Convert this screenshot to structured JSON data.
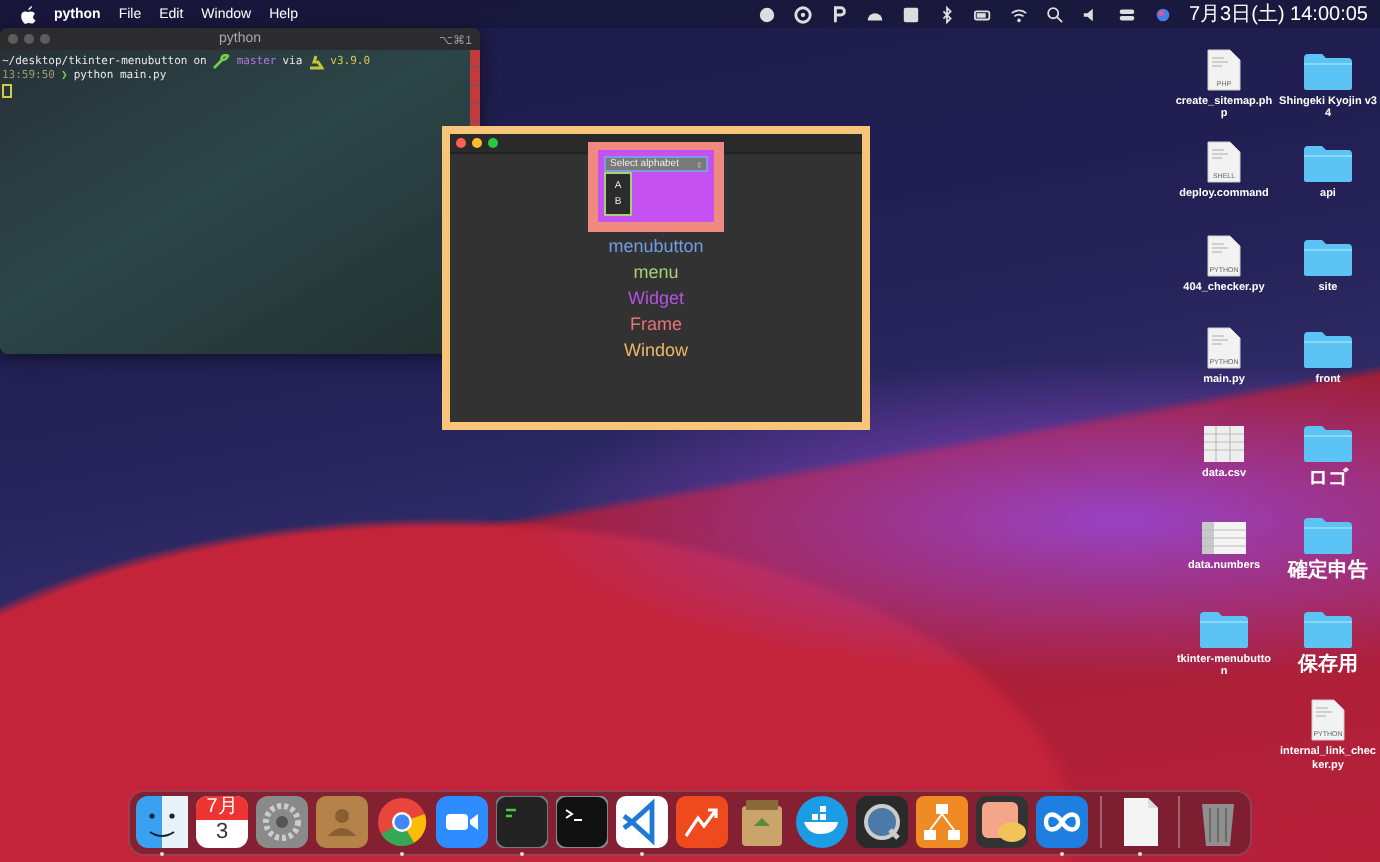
{
  "menu_bar": {
    "app": "python",
    "items": [
      "File",
      "Edit",
      "Window",
      "Help"
    ],
    "clock": "7月3日(土) 14:00:05"
  },
  "terminal": {
    "title": "python",
    "shortcut": "⌥⌘1",
    "prompt": {
      "path": "~/desktop/tkinter-menubutton",
      "on": "on",
      "branch": "master",
      "via": "via",
      "version": "v3.9.0"
    },
    "command_line": {
      "time": "13:59:50",
      "symbol": "❯",
      "command": "python main.py"
    }
  },
  "tk_window": {
    "menubutton": {
      "label": "Select alphabet",
      "arrow": "⇕"
    },
    "menu_items": [
      "A",
      "B"
    ],
    "legend": [
      {
        "label": "menubutton",
        "color": "#6f9de6"
      },
      {
        "label": "menu",
        "color": "#a3d374"
      },
      {
        "label": "Widget",
        "color": "#b552e6"
      },
      {
        "label": "Frame",
        "color": "#ea7474"
      },
      {
        "label": "Window",
        "color": "#edb868"
      }
    ]
  },
  "desktop_icons": [
    {
      "name": "create_sitemap.php",
      "kind": "document",
      "tag": "PHP"
    },
    {
      "name": "Shingeki Kyojin v34",
      "kind": "folder"
    },
    {
      "name": "deploy.command",
      "kind": "document",
      "tag": "SHELL"
    },
    {
      "name": "api",
      "kind": "folder"
    },
    {
      "name": "404_checker.py",
      "kind": "document",
      "tag": "PYTHON"
    },
    {
      "name": "site",
      "kind": "folder"
    },
    {
      "name": "main.py",
      "kind": "document",
      "tag": "PYTHON"
    },
    {
      "name": "front",
      "kind": "folder"
    },
    {
      "name": "data.csv",
      "kind": "sheet"
    },
    {
      "name": "ロゴ",
      "kind": "folder"
    },
    {
      "name": "data.numbers",
      "kind": "numbers"
    },
    {
      "name": "確定申告",
      "kind": "folder"
    },
    {
      "name": "tkinter-menubutton",
      "kind": "folder"
    },
    {
      "name": "保存用",
      "kind": "folder"
    },
    {
      "name": "internal_link_checker.py",
      "kind": "document",
      "tag": "PYTHON"
    }
  ],
  "dock": {
    "calendar": {
      "month": "7月",
      "day": "3"
    },
    "items": [
      {
        "kind": "finder",
        "running": true
      },
      {
        "kind": "calendar",
        "running": false
      },
      {
        "kind": "settings",
        "running": false
      },
      {
        "kind": "contacts",
        "running": false
      },
      {
        "kind": "chrome",
        "running": true
      },
      {
        "kind": "zoom",
        "running": false
      },
      {
        "kind": "monitor",
        "running": true
      },
      {
        "kind": "terminal",
        "running": false
      },
      {
        "kind": "vscode",
        "running": true
      },
      {
        "kind": "chart",
        "running": false
      },
      {
        "kind": "archive",
        "running": false
      },
      {
        "kind": "docker",
        "running": false
      },
      {
        "kind": "quicktime",
        "running": false
      },
      {
        "kind": "diagram",
        "running": false
      },
      {
        "kind": "preview",
        "running": false
      },
      {
        "kind": "infinity",
        "running": true
      },
      {
        "kind": "divider"
      },
      {
        "kind": "file",
        "running": true
      },
      {
        "kind": "divider"
      },
      {
        "kind": "trash",
        "running": false
      }
    ]
  }
}
